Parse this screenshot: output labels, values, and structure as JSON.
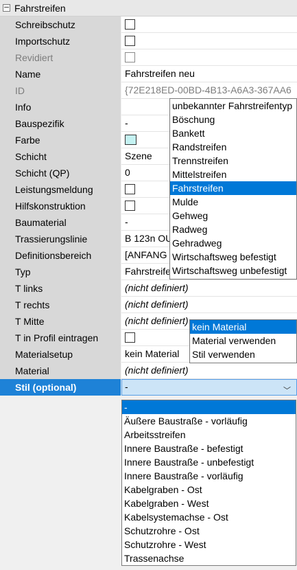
{
  "header": {
    "toggle_glyph": "−",
    "title": "Fahrstreifen"
  },
  "rows": [
    {
      "label": "Schreibschutz",
      "kind": "checkbox"
    },
    {
      "label": "Importschutz",
      "kind": "checkbox"
    },
    {
      "label": "Revidiert",
      "kind": "checkbox",
      "disabled": true
    },
    {
      "label": "Name",
      "value": "Fahrstreifen neu"
    },
    {
      "label": "ID",
      "value": "{72E218ED-00BD-4B13-A6A3-367AA6",
      "disabled": true
    },
    {
      "label": "Info",
      "value": ""
    },
    {
      "label": "Bauspezifik",
      "value": "-"
    },
    {
      "label": "Farbe",
      "kind": "color",
      "color": "#c4f2f2"
    },
    {
      "label": "Schicht",
      "value": "Szene"
    },
    {
      "label": "Schicht (QP)",
      "value": "0"
    },
    {
      "label": "Leistungsmeldung",
      "kind": "checkbox"
    },
    {
      "label": "Hilfskonstruktion",
      "kind": "checkbox"
    },
    {
      "label": "Baumaterial",
      "value": "-"
    },
    {
      "label": "Trassierungslinie",
      "value": "B 123n OU"
    },
    {
      "label": "Definitionsbereich",
      "value": "[ANFANG"
    },
    {
      "label": "Typ",
      "value": "Fahrstreifen"
    },
    {
      "label": "T links",
      "value": "(nicht definiert)",
      "italic": true
    },
    {
      "label": "T rechts",
      "value": "(nicht definiert)",
      "italic": true
    },
    {
      "label": "T Mitte",
      "value": "(nicht definiert)",
      "italic": true
    },
    {
      "label": "T in Profil eintragen",
      "kind": "checkbox"
    },
    {
      "label": "Materialsetup",
      "value": "kein Material"
    },
    {
      "label": "Material",
      "value": "(nicht definiert)",
      "italic": true
    },
    {
      "label": "Stil (optional)",
      "value": "-",
      "selected": true,
      "chevron": "﹀"
    }
  ],
  "type_dropdown": {
    "options": [
      "unbekannter Fahrstreifentyp",
      "Böschung",
      "Bankett",
      "Randstreifen",
      "Trennstreifen",
      "Mittelstreifen",
      "Fahrstreifen",
      "Mulde",
      "Gehweg",
      "Radweg",
      "Gehradweg",
      "Wirtschaftsweg befestigt",
      "Wirtschaftsweg unbefestigt"
    ],
    "highlighted": 6
  },
  "material_dropdown": {
    "options": [
      "kein Material",
      "Material verwenden",
      "Stil verwenden"
    ],
    "highlighted": 0
  },
  "stil_dropdown": {
    "options": [
      "-",
      "Äußere Baustraße - vorläufig",
      "Arbeitsstreifen",
      "Innere Baustraße - befestigt",
      "Innere Baustraße - unbefestigt",
      "Innere Baustraße - vorläufig",
      "Kabelgraben - Ost",
      "Kabelgraben - West",
      "Kabelsystemachse - Ost",
      "Schutzrohre - Ost",
      "Schutzrohre - West",
      "Trassenachse"
    ],
    "highlighted": 0
  }
}
